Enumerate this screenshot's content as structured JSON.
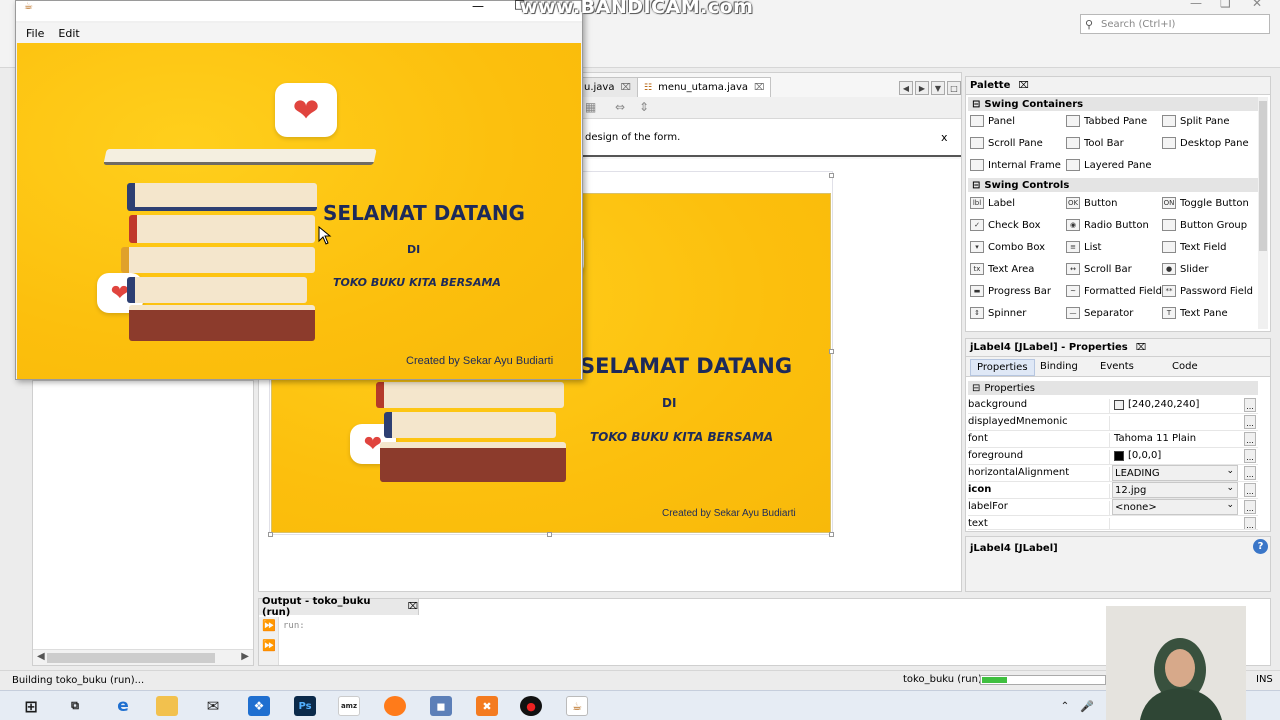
{
  "watermark": "www.BANDICAM.com",
  "ide": {
    "search_placeholder": "Search (Ctrl+I)",
    "editor_tabs": [
      {
        "label": "u.java",
        "active": false
      },
      {
        "label": "menu_utama.java",
        "active": true
      }
    ],
    "info_message": "design of the form.",
    "info_close": "x",
    "palette": {
      "title": "Palette",
      "sections": [
        {
          "label": "Swing Containers",
          "items": [
            "Panel",
            "Tabbed Pane",
            "Split Pane",
            "Scroll Pane",
            "Tool Bar",
            "Desktop Pane",
            "Internal Frame",
            "Layered Pane"
          ]
        },
        {
          "label": "Swing Controls",
          "items": [
            "Label",
            "Button",
            "Toggle Button",
            "Check Box",
            "Radio Button",
            "Button Group",
            "Combo Box",
            "List",
            "Text Field",
            "Text Area",
            "Scroll Bar",
            "Slider",
            "Progress Bar",
            "Formatted Field",
            "Password Field",
            "Spinner",
            "Separator",
            "Text Pane"
          ]
        }
      ]
    },
    "properties": {
      "title": "jLabel4 [JLabel] - Properties",
      "tabs": [
        "Properties",
        "Binding",
        "Events",
        "Code"
      ],
      "section": "Properties",
      "rows": [
        {
          "key": "background",
          "value": "[240,240,240]",
          "swatch": "#f0f0f0"
        },
        {
          "key": "displayedMnemonic",
          "value": ""
        },
        {
          "key": "font",
          "value": "Tahoma 11 Plain"
        },
        {
          "key": "foreground",
          "value": "[0,0,0]",
          "swatch": "#000000"
        },
        {
          "key": "horizontalAlignment",
          "value": "LEADING",
          "combo": true
        },
        {
          "key": "icon",
          "value": "12.jpg",
          "combo": true,
          "bold": true
        },
        {
          "key": "labelFor",
          "value": "<none>",
          "combo": true
        },
        {
          "key": "text",
          "value": ""
        }
      ],
      "footer": "jLabel4 [JLabel]"
    },
    "output": {
      "title": "Output - toko_buku (run)",
      "text": "run:"
    },
    "status": {
      "left": "Building toko_buku (run)...",
      "project": "toko_buku (run)",
      "progress": 0.2,
      "mode": "INS"
    }
  },
  "app": {
    "menu": [
      "File",
      "Edit"
    ],
    "greeting": "SELAMAT DATANG",
    "di": "DI",
    "store": "TOKO BUKU KITA BERSAMA",
    "credit": "Created by Sekar Ayu Budiarti"
  },
  "taskbar": {
    "icons": [
      "windows-start",
      "task-view",
      "edge",
      "file-explorer",
      "mail",
      "dropbox",
      "photoshop",
      "amazon",
      "firefox",
      "virtualbox",
      "xampp",
      "record",
      "java"
    ]
  },
  "colors": {
    "banner_yellow": "#fcbf0d",
    "heading_navy": "#1d2a5a",
    "accent_blue": "#3a76c8"
  }
}
